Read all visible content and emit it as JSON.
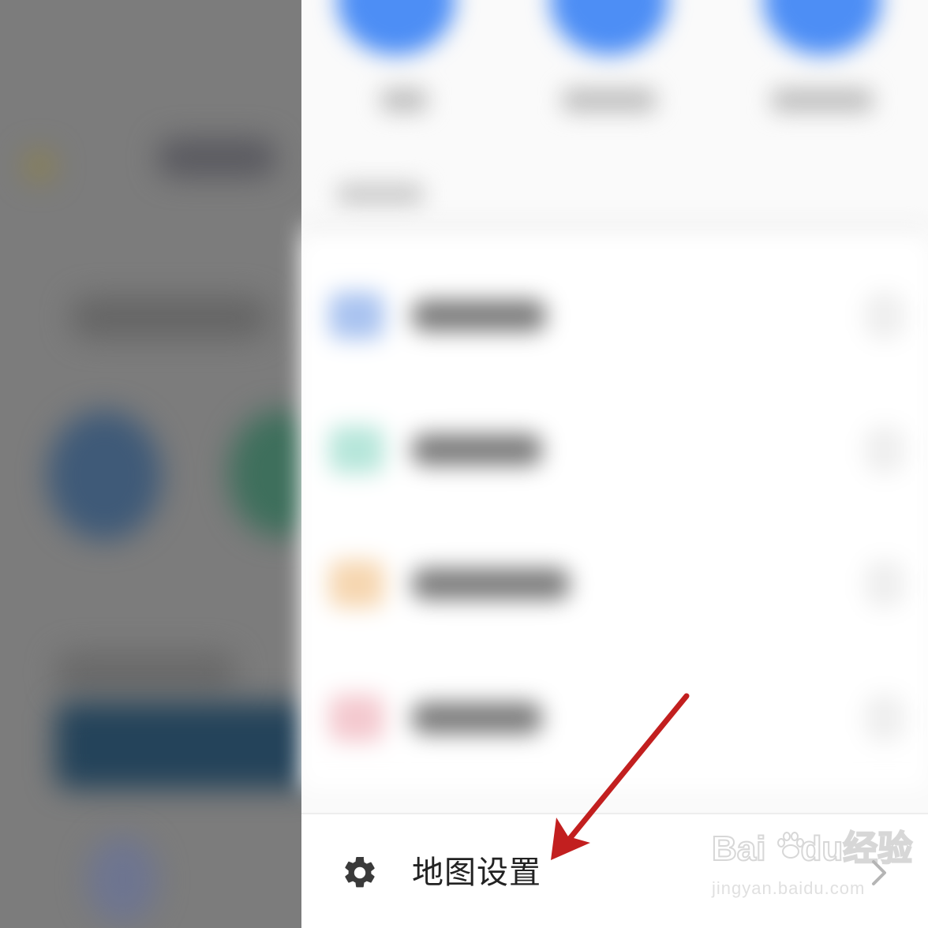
{
  "settings_bar": {
    "label": "地图设置",
    "icon": "gear-icon",
    "chevron_icon": "chevron-right-icon"
  },
  "watermark": {
    "main_prefix": "Bai",
    "main_suffix": "du",
    "main_cn": "经验",
    "sub": "jingyan.baidu.com"
  },
  "colors": {
    "accent_blue": "#4d8ef5",
    "annotation_arrow": "#c21f1f"
  }
}
